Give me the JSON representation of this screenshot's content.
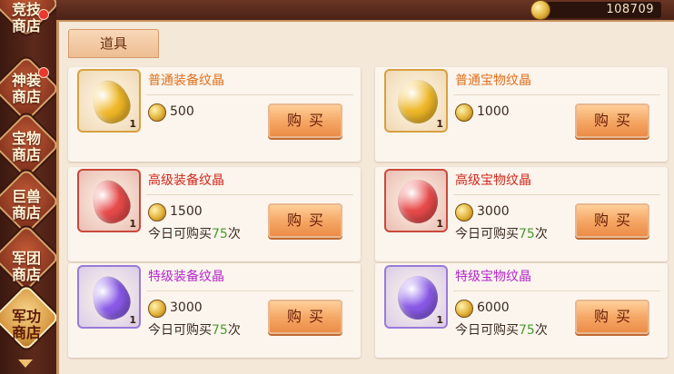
{
  "currency": {
    "icon": "gold-coin-icon",
    "value": "108709"
  },
  "sidebar": {
    "items": [
      {
        "label": "竞技\n商店",
        "active": false,
        "badge": true
      },
      {
        "label": "神装\n商店",
        "active": false,
        "badge": true
      },
      {
        "label": "宝物\n商店",
        "active": false,
        "badge": false
      },
      {
        "label": "巨兽\n商店",
        "active": false,
        "badge": false
      },
      {
        "label": "军团\n商店",
        "active": false,
        "badge": false
      },
      {
        "label": "军功\n商店",
        "active": true,
        "badge": false
      }
    ]
  },
  "tab": {
    "label": "道具"
  },
  "items": [
    {
      "name": "普通装备纹晶",
      "name_color": "#e0701c",
      "gem_color": "#f0b828",
      "frame_color": "#d8a040",
      "quantity": "1",
      "price": "500",
      "limit_prefix": "",
      "limit_num": "",
      "limit_suffix": "",
      "buy_label": "购买"
    },
    {
      "name": "普通宝物纹晶",
      "name_color": "#e0701c",
      "gem_color": "#f0b828",
      "frame_color": "#d8a040",
      "quantity": "1",
      "price": "1000",
      "limit_prefix": "",
      "limit_num": "",
      "limit_suffix": "",
      "buy_label": "购买"
    },
    {
      "name": "高级装备纹晶",
      "name_color": "#d0281c",
      "gem_color": "#e84a4a",
      "frame_color": "#c84a3a",
      "quantity": "1",
      "price": "1500",
      "limit_prefix": "今日可购买",
      "limit_num": "75",
      "limit_suffix": "次",
      "buy_label": "购买"
    },
    {
      "name": "高级宝物纹晶",
      "name_color": "#d0281c",
      "gem_color": "#e84a4a",
      "frame_color": "#c84a3a",
      "quantity": "1",
      "price": "3000",
      "limit_prefix": "今日可购买",
      "limit_num": "75",
      "limit_suffix": "次",
      "buy_label": "购买"
    },
    {
      "name": "特级装备纹晶",
      "name_color": "#b428c8",
      "gem_color": "#8a5ae8",
      "frame_color": "#9a7ad8",
      "quantity": "1",
      "price": "3000",
      "limit_prefix": "今日可购买",
      "limit_num": "75",
      "limit_suffix": "次",
      "buy_label": "购买"
    },
    {
      "name": "特级宝物纹晶",
      "name_color": "#b428c8",
      "gem_color": "#8a5ae8",
      "frame_color": "#9a7ad8",
      "quantity": "1",
      "price": "6000",
      "limit_prefix": "今日可购买",
      "limit_num": "75",
      "limit_suffix": "次",
      "buy_label": "购买"
    }
  ]
}
